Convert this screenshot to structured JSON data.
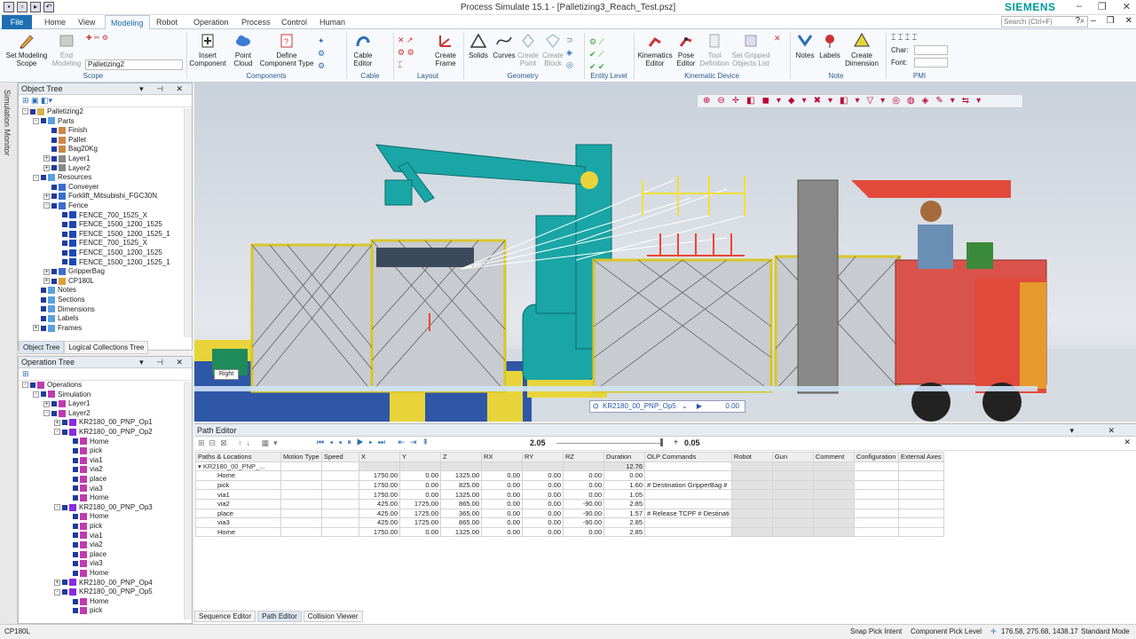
{
  "window": {
    "title": "Process Simulate 15.1 - [Palletizing3_Reach_Test.psz]",
    "brand": "SIEMENS"
  },
  "menu": {
    "tabs": [
      "File",
      "Home",
      "View",
      "Modeling",
      "Robot",
      "Operation",
      "Process",
      "Control",
      "Human"
    ],
    "active": "Modeling",
    "search_placeholder": "Search (Ctrl+F)"
  },
  "ribbon": {
    "scope": {
      "set_label": "Set Modeling\nScope",
      "end_label": "End\nModeling",
      "dropdown": "Palletizing2",
      "group": "Scope"
    },
    "components": {
      "insert": "Insert\nComponent",
      "point_cloud": "Point\nCloud",
      "define": "Define\nComponent Type",
      "group": "Components"
    },
    "cable": {
      "editor": "Cable\nEditor",
      "group": "Cable"
    },
    "layout": {
      "create_frame": "Create\nFrame",
      "group": "Layout"
    },
    "geometry": {
      "solids": "Solids",
      "curves": "Curves",
      "create_point": "Create\nPoint",
      "create_block": "Create\nBlock",
      "group": "Geometry"
    },
    "entity": {
      "group": "Entity Level"
    },
    "kinematic": {
      "kin_editor": "Kinematics\nEditor",
      "pose_editor": "Pose\nEditor",
      "tool_def": "Tool\nDefinition",
      "gripped": "Set Gripped\nObjects List",
      "group": "Kinematic Device"
    },
    "note": {
      "notes": "Notes",
      "labels": "Labels",
      "create_dim": "Create\nDimension",
      "group": "Note"
    },
    "pmi": {
      "char_label": "Char:",
      "font_label": "Font:",
      "group": "PMI"
    }
  },
  "object_tree": {
    "title": "Object Tree",
    "items": [
      {
        "d": 0,
        "t": "Palletizing2",
        "e": "-",
        "c": "#d8b24a"
      },
      {
        "d": 1,
        "t": "Parts",
        "e": "-",
        "c": "#5aa0e0"
      },
      {
        "d": 2,
        "t": "Finish",
        "e": "",
        "c": "#c84"
      },
      {
        "d": 2,
        "t": "Pallet",
        "e": "",
        "c": "#c84"
      },
      {
        "d": 2,
        "t": "Bag20Kg",
        "e": "",
        "c": "#c84"
      },
      {
        "d": 2,
        "t": "Layer1",
        "e": "+",
        "c": "#888"
      },
      {
        "d": 2,
        "t": "Layer2",
        "e": "+",
        "c": "#888"
      },
      {
        "d": 1,
        "t": "Resources",
        "e": "-",
        "c": "#5aa0e0"
      },
      {
        "d": 2,
        "t": "Conveyer",
        "e": "",
        "c": "#3a6fd0"
      },
      {
        "d": 2,
        "t": "Forklift_Mitsubishi_FGC30N",
        "e": "+",
        "c": "#3a6fd0"
      },
      {
        "d": 2,
        "t": "Fence",
        "e": "-",
        "c": "#3a6fd0"
      },
      {
        "d": 3,
        "t": "FENCE_700_1525_X",
        "e": "",
        "c": "#1b49b8"
      },
      {
        "d": 3,
        "t": "FENCE_1500_1200_1525",
        "e": "",
        "c": "#1b49b8"
      },
      {
        "d": 3,
        "t": "FENCE_1500_1200_1525_1",
        "e": "",
        "c": "#1b49b8"
      },
      {
        "d": 3,
        "t": "FENCE_700_1525_X",
        "e": "",
        "c": "#1b49b8"
      },
      {
        "d": 3,
        "t": "FENCE_1500_1200_1525",
        "e": "",
        "c": "#1b49b8"
      },
      {
        "d": 3,
        "t": "FENCE_1500_1200_1525_1",
        "e": "",
        "c": "#1b49b8"
      },
      {
        "d": 2,
        "t": "GripperBag",
        "e": "+",
        "c": "#3a6fd0"
      },
      {
        "d": 2,
        "t": "CP180L",
        "e": "+",
        "c": "#e0a030"
      },
      {
        "d": 1,
        "t": "Notes",
        "e": "",
        "c": "#5aa0e0"
      },
      {
        "d": 1,
        "t": "Sections",
        "e": "",
        "c": "#5aa0e0"
      },
      {
        "d": 1,
        "t": "Dimensions",
        "e": "",
        "c": "#5aa0e0"
      },
      {
        "d": 1,
        "t": "Labels",
        "e": "",
        "c": "#5aa0e0"
      },
      {
        "d": 1,
        "t": "Frames",
        "e": "+",
        "c": "#5aa0e0"
      }
    ],
    "tabs": [
      "Object Tree",
      "Logical Collections Tree"
    ]
  },
  "operation_tree": {
    "title": "Operation Tree",
    "items": [
      {
        "d": 0,
        "t": "Operations",
        "e": "-",
        "c": "#c03bb0"
      },
      {
        "d": 1,
        "t": "Simulation",
        "e": "-",
        "c": "#c03bb0"
      },
      {
        "d": 2,
        "t": "Layer1",
        "e": "+",
        "c": "#c03bb0"
      },
      {
        "d": 2,
        "t": "Layer2",
        "e": "-",
        "c": "#c03bb0"
      },
      {
        "d": 3,
        "t": "KR2180_00_PNP_Op1",
        "e": "+",
        "c": "#8a2be2"
      },
      {
        "d": 3,
        "t": "KR2180_00_PNP_Op2",
        "e": "-",
        "c": "#8a2be2"
      },
      {
        "d": 4,
        "t": "Home",
        "e": "",
        "c": "#c03bb0"
      },
      {
        "d": 4,
        "t": "pick",
        "e": "",
        "c": "#c03bb0"
      },
      {
        "d": 4,
        "t": "via1",
        "e": "",
        "c": "#c03bb0"
      },
      {
        "d": 4,
        "t": "via2",
        "e": "",
        "c": "#c03bb0"
      },
      {
        "d": 4,
        "t": "place",
        "e": "",
        "c": "#c03bb0"
      },
      {
        "d": 4,
        "t": "via3",
        "e": "",
        "c": "#c03bb0"
      },
      {
        "d": 4,
        "t": "Home",
        "e": "",
        "c": "#c03bb0"
      },
      {
        "d": 3,
        "t": "KR2180_00_PNP_Op3",
        "e": "-",
        "c": "#8a2be2"
      },
      {
        "d": 4,
        "t": "Home",
        "e": "",
        "c": "#c03bb0"
      },
      {
        "d": 4,
        "t": "pick",
        "e": "",
        "c": "#c03bb0"
      },
      {
        "d": 4,
        "t": "via1",
        "e": "",
        "c": "#c03bb0"
      },
      {
        "d": 4,
        "t": "via2",
        "e": "",
        "c": "#c03bb0"
      },
      {
        "d": 4,
        "t": "place",
        "e": "",
        "c": "#c03bb0"
      },
      {
        "d": 4,
        "t": "via3",
        "e": "",
        "c": "#c03bb0"
      },
      {
        "d": 4,
        "t": "Home",
        "e": "",
        "c": "#c03bb0"
      },
      {
        "d": 3,
        "t": "KR2180_00_PNP_Op4",
        "e": "+",
        "c": "#8a2be2"
      },
      {
        "d": 3,
        "t": "KR2180_00_PNP_Op5",
        "e": "-",
        "c": "#8a2be2"
      },
      {
        "d": 4,
        "t": "Home",
        "e": "",
        "c": "#c03bb0"
      },
      {
        "d": 4,
        "t": "pick",
        "e": "",
        "c": "#c03bb0"
      }
    ]
  },
  "viewport": {
    "op_name": "KR2180_00_PNP_Op5",
    "op_time": "0.00",
    "view_label": "Right"
  },
  "path_editor": {
    "title": "Path Editor",
    "time": "2.05",
    "step": "0.05",
    "columns": [
      "Paths & Locations",
      "Motion Type",
      "Speed",
      "X",
      "Y",
      "Z",
      "RX",
      "RY",
      "RZ",
      "Duration",
      "OLP Commands",
      "Robot",
      "Gun",
      "Comment",
      "Configuration",
      "External Axes"
    ],
    "path_row": {
      "name": "KR2180_00_PNP_...",
      "duration": "12.76"
    },
    "rows": [
      {
        "n": "Home",
        "x": "1750.00",
        "y": "0.00",
        "z": "1325.00",
        "rx": "0.00",
        "ry": "0.00",
        "rz": "0.00",
        "d": "0.00",
        "olp": ""
      },
      {
        "n": "pick",
        "x": "1750.00",
        "y": "0.00",
        "z": "825.00",
        "rx": "0.00",
        "ry": "0.00",
        "rz": "0.00",
        "d": "1.60",
        "olp": "# Destination  GripperBag  #"
      },
      {
        "n": "via1",
        "x": "1750.00",
        "y": "0.00",
        "z": "1325.00",
        "rx": "0.00",
        "ry": "0.00",
        "rz": "0.00",
        "d": "1.05",
        "olp": ""
      },
      {
        "n": "via2",
        "x": "425.00",
        "y": "1725.00",
        "z": "865.00",
        "rx": "0.00",
        "ry": "0.00",
        "rz": "-90.00",
        "d": "2.85",
        "olp": ""
      },
      {
        "n": "place",
        "x": "425.00",
        "y": "1725.00",
        "z": "365.00",
        "rx": "0.00",
        "ry": "0.00",
        "rz": "-90.00",
        "d": "1.57",
        "olp": "# Release  TCPF  # Destinati"
      },
      {
        "n": "via3",
        "x": "425.00",
        "y": "1725.00",
        "z": "865.00",
        "rx": "0.00",
        "ry": "0.00",
        "rz": "-90.00",
        "d": "2.85",
        "olp": ""
      },
      {
        "n": "Home",
        "x": "1750.00",
        "y": "0.00",
        "z": "1325.00",
        "rx": "0.00",
        "ry": "0.00",
        "rz": "0.00",
        "d": "2.85",
        "olp": ""
      }
    ]
  },
  "bottom_tabs": [
    "Sequence Editor",
    "Path Editor",
    "Collision Viewer"
  ],
  "left_strip": "Simulation Monitor",
  "status": {
    "left": "CP180L",
    "snap": "Snap Pick Intent",
    "pick": "Component Pick Level",
    "coords": "176.58, 275.68, 1438.17",
    "mode": "Standard Mode"
  }
}
